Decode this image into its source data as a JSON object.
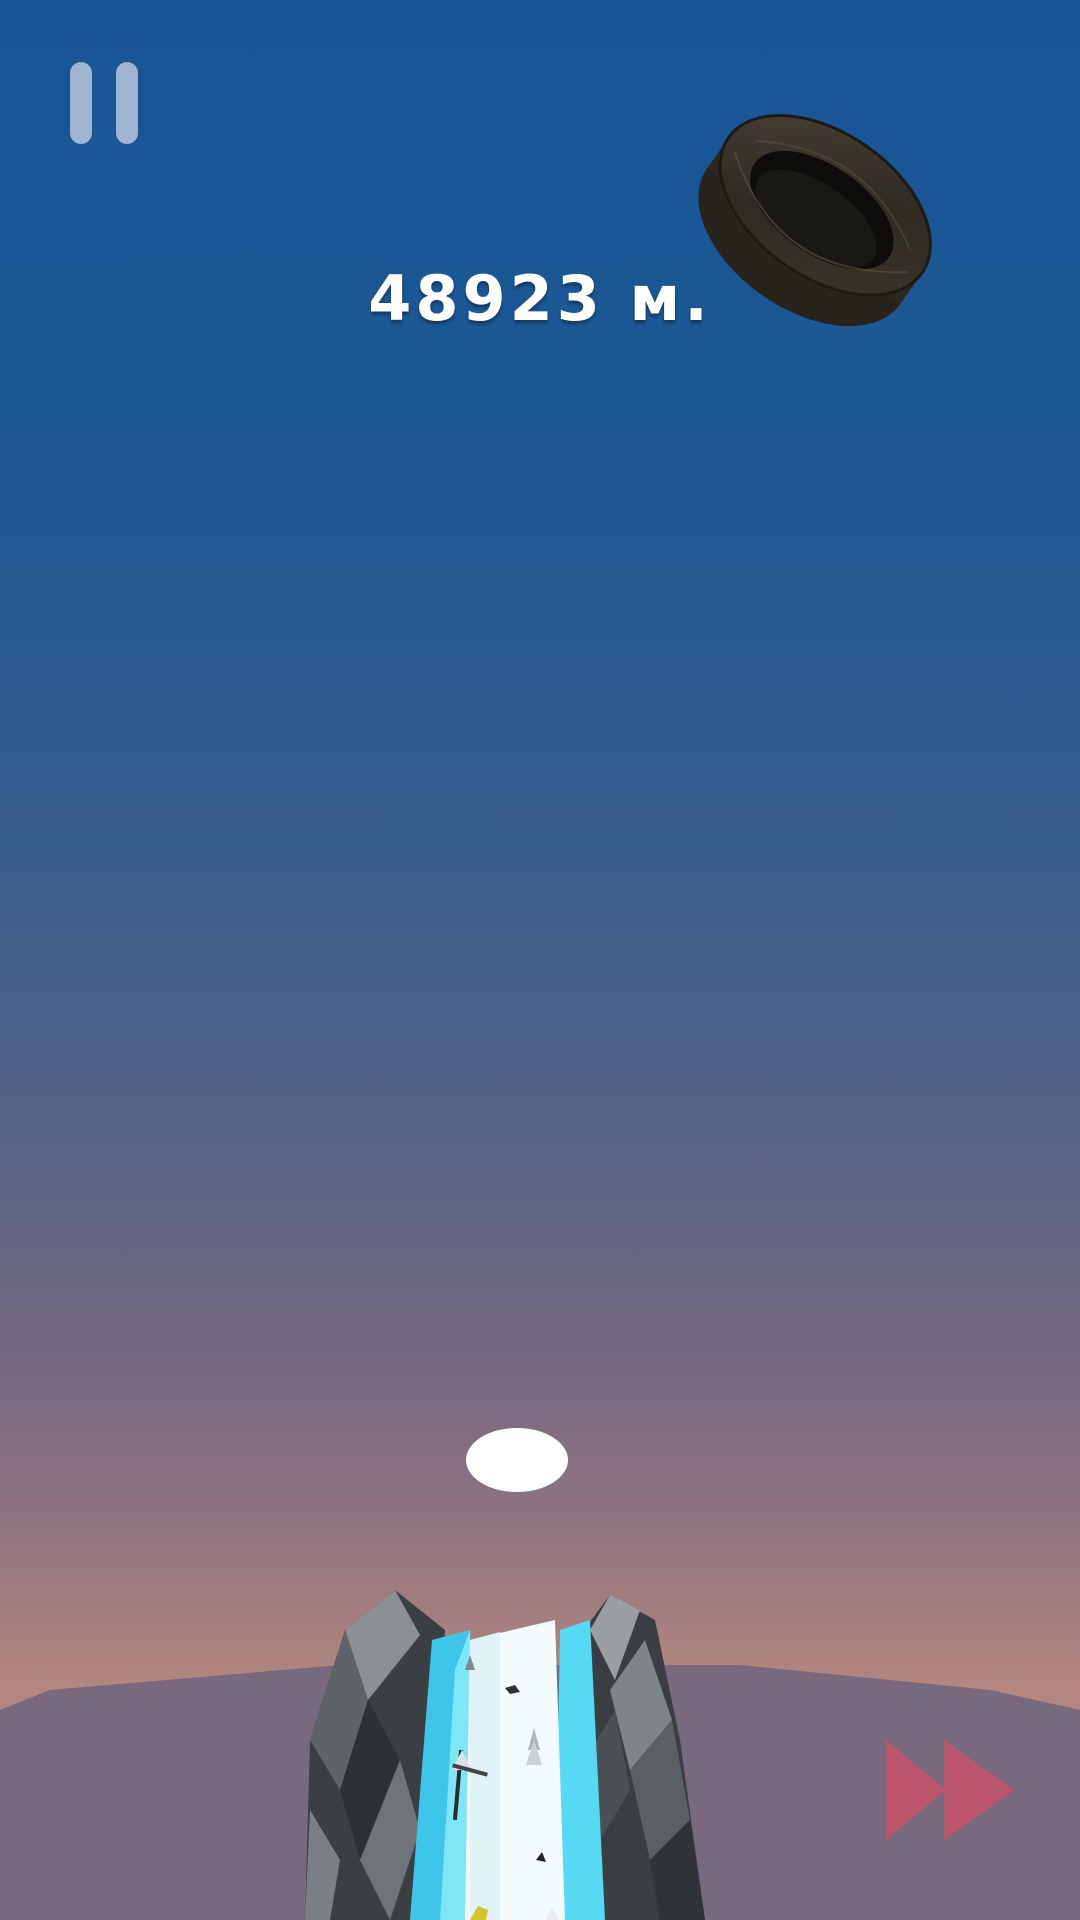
{
  "hud": {
    "distance_value": "48923",
    "distance_unit": "м."
  },
  "icons": {
    "pause": "pause-icon",
    "skip": "fast-forward-icon",
    "obstacle": "tire",
    "player": "ball"
  },
  "colors": {
    "sky_top": "#175596",
    "sky_bottom": "#b4867f",
    "pause": "#cdd4e6",
    "skip": "#c8546a",
    "ice": "#4fd3f0",
    "snow": "#ffffff",
    "rock": "#4a4e52"
  }
}
